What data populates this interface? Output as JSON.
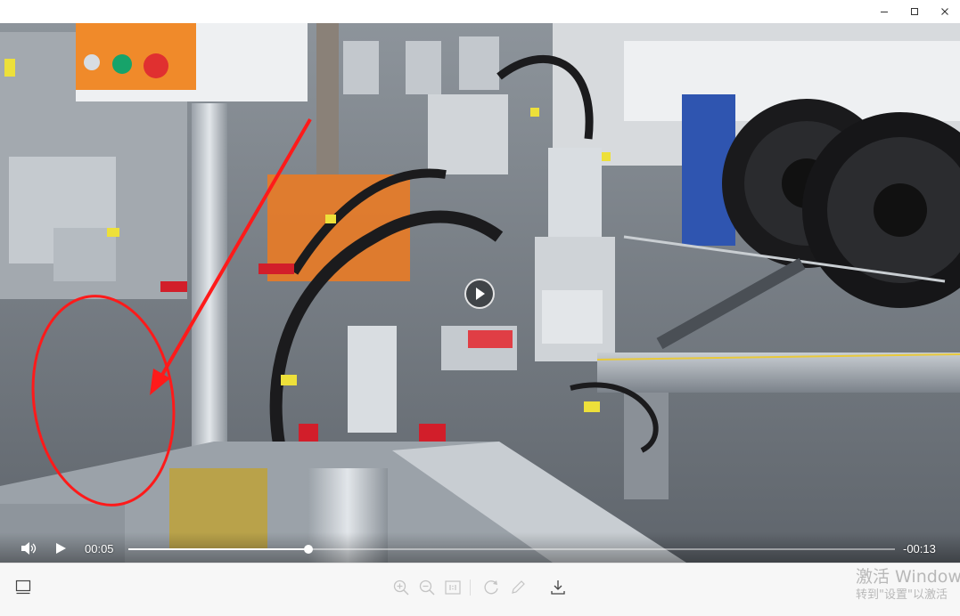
{
  "window": {
    "minimize_icon": "minimize-icon",
    "maximize_icon": "maximize-icon",
    "close_icon": "close-icon"
  },
  "player": {
    "current_time": "00:05",
    "remaining_time": "-00:13",
    "progress": 0.235,
    "volume_icon": "volume-icon",
    "play_icon": "play-icon"
  },
  "toolbar": {
    "left_icon": "thumbnail-panel-icon",
    "icons": [
      "zoom-in-icon",
      "zoom-out-icon",
      "actual-size-icon",
      "rotate-icon",
      "edit-icon",
      "download-icon"
    ]
  },
  "watermark": {
    "line1": "激活 Window",
    "line2": "转到\"设置\"以激活"
  },
  "colors": {
    "annotation_red": "#ff1a1a",
    "cable_orange": "#f07a1e"
  }
}
